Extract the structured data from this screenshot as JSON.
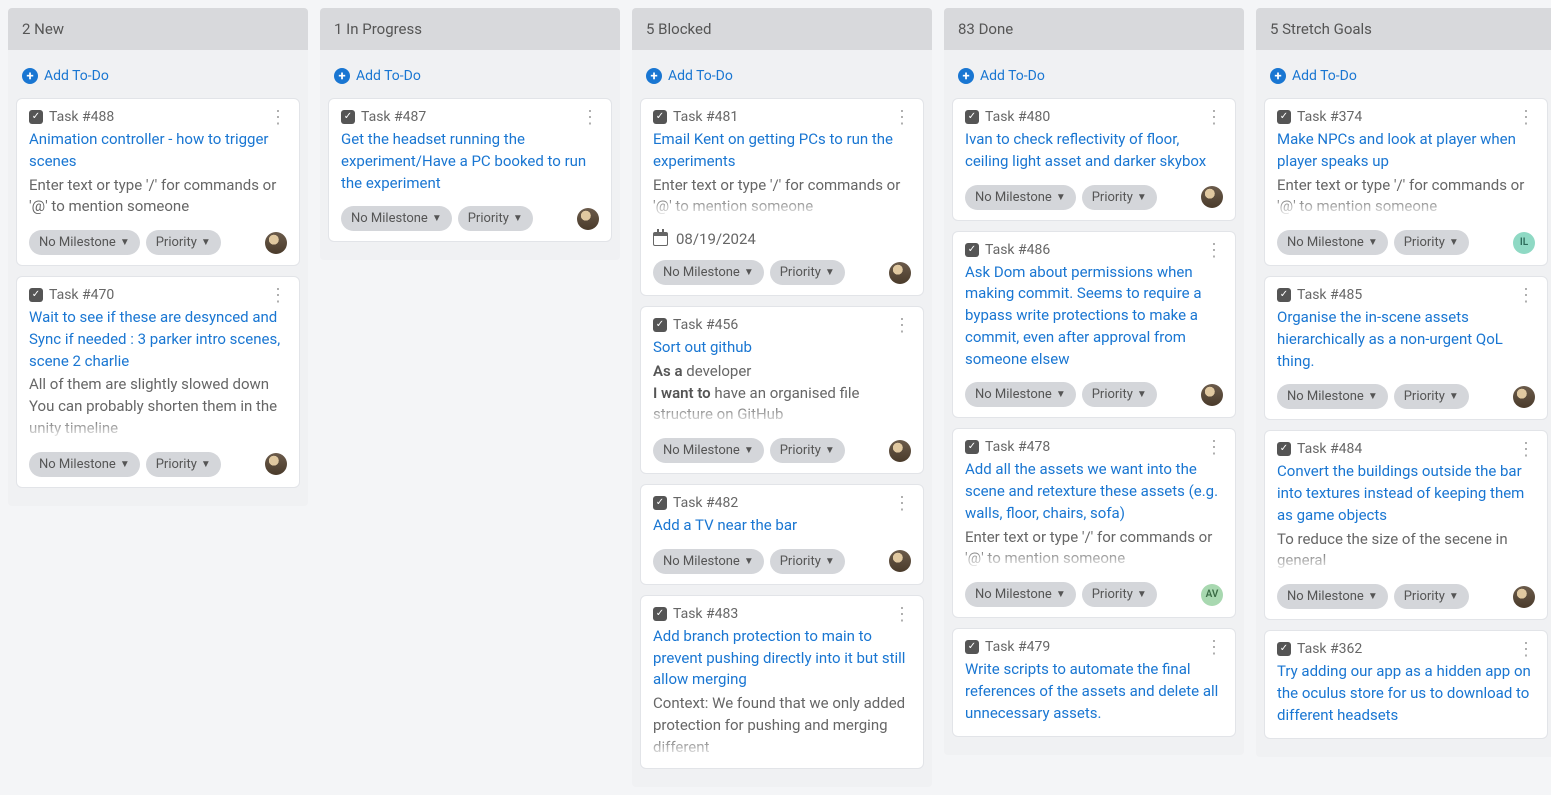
{
  "labels": {
    "add_todo": "Add To-Do",
    "no_milestone": "No Milestone",
    "priority": "Priority"
  },
  "columns": [
    {
      "header": "2 New",
      "cards": [
        {
          "id": "Task #488",
          "title": "Animation controller - how to trigger scenes",
          "desc": "Enter text or type '/' for commands or '@' to mention someone",
          "fade": false,
          "avatar": "photo"
        },
        {
          "id": "Task #470",
          "title": "Wait to see if these are desynced and Sync if needed : 3 parker intro scenes, scene 2 charlie",
          "desc": "All of them are slightly slowed down\nYou can probably shorten them in the unity timeline",
          "fade": true,
          "avatar": "photo"
        }
      ]
    },
    {
      "header": "1 In Progress",
      "cards": [
        {
          "id": "Task #487",
          "title": "Get the headset running the experiment/Have a PC booked to run the experiment",
          "desc": "",
          "avatar": "photo"
        }
      ]
    },
    {
      "header": "5 Blocked",
      "cards": [
        {
          "id": "Task #481",
          "title": "Email Kent on getting PCs to run the experiments",
          "desc": "Enter text or type '/' for commands or '@' to mention someone",
          "fade": true,
          "date": "08/19/2024",
          "avatar": "photo"
        },
        {
          "id": "Task #456",
          "title": "Sort out github",
          "rich": [
            [
              "b",
              "As a "
            ],
            [
              "",
              "developer"
            ],
            [
              "br",
              ""
            ],
            [
              "b",
              "I want to "
            ],
            [
              "",
              "have an organised file structure on GitHub"
            ]
          ],
          "fade": true,
          "avatar": "photo"
        },
        {
          "id": "Task #482",
          "title": "Add a TV near the bar",
          "desc": "",
          "avatar": "photo"
        },
        {
          "id": "Task #483",
          "title": "Add branch protection to main to prevent pushing directly into it but still allow merging",
          "desc": "Context:\nWe found that we only added protection for pushing and merging different",
          "fade": true,
          "nometa": true
        }
      ]
    },
    {
      "header": "83 Done",
      "cards": [
        {
          "id": "Task #480",
          "title": "Ivan to check reflectivity of floor, ceiling light asset and darker skybox",
          "desc": "",
          "avatar": "photo"
        },
        {
          "id": "Task #486",
          "title": "Ask Dom about permissions when making commit. Seems to require a bypass write protections to make a commit, even after approval from someone elsew",
          "desc": "",
          "avatar": "photo"
        },
        {
          "id": "Task #478",
          "title": "Add all the assets we want into the scene and retexture these assets (e.g. walls, floor, chairs, sofa)",
          "desc": "Enter text or type '/' for commands or '@' to mention someone",
          "fade": true,
          "avatar": "av",
          "avlabel": "AV"
        },
        {
          "id": "Task #479",
          "title": "Write scripts to automate the final references of the assets and delete all unnecessary assets.",
          "desc": "",
          "nometa": true
        }
      ]
    },
    {
      "header": "5 Stretch Goals",
      "cards": [
        {
          "id": "Task #374",
          "title": "Make NPCs and look at player when player speaks up",
          "desc": "Enter text or type '/' for commands or '@' to mention someone",
          "fade": true,
          "avatar": "green",
          "avlabel": "IL"
        },
        {
          "id": "Task #485",
          "title": "Organise the in-scene assets hierarchically as a non-urgent QoL thing.",
          "desc": "",
          "avatar": "photo"
        },
        {
          "id": "Task #484",
          "title": "Convert the buildings outside the bar into textures instead of keeping them as game objects",
          "desc": "To reduce the size of the secene in general",
          "fade": true,
          "avatar": "photo"
        },
        {
          "id": "Task #362",
          "title": "Try adding our app as a hidden app on the oculus store for us to download to different headsets",
          "desc": "",
          "nometa": true
        }
      ]
    }
  ]
}
